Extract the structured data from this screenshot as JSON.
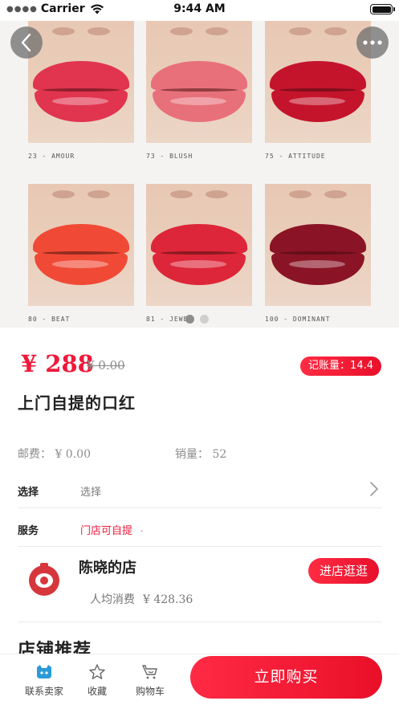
{
  "status_bar": {
    "carrier": "Carrier",
    "time": "9:44 AM"
  },
  "gallery": {
    "shades": [
      {
        "label": "23 - AMOUR",
        "color": "#e0344f"
      },
      {
        "label": "73 - BLUSH",
        "color": "#e8707a"
      },
      {
        "label": "75 - ATTITUDE",
        "color": "#c4142c"
      },
      {
        "label": "80 - BEAT",
        "color": "#f04a36"
      },
      {
        "label": "81 - JEWEL",
        "color": "#dd2639"
      },
      {
        "label": "100 - DOMINANT",
        "color": "#8a1425"
      }
    ],
    "page_count": 2,
    "active_page": 0
  },
  "product": {
    "price": "¥ 288",
    "original_price": "¥ 0.00",
    "badge": "记账量：14.4",
    "title": "上门自提的口红",
    "shipping_label": "邮费：",
    "shipping_value": "¥ 0.00",
    "sales_label": "销量：",
    "sales_value": "52"
  },
  "options": {
    "select_label": "选择",
    "select_value": "选择",
    "service_label": "服务",
    "service_value": "门店可自提",
    "service_dot": "·"
  },
  "store": {
    "name": "陈晓的店",
    "avg_label": "人均消费",
    "avg_value": "¥ 428.36",
    "visit_button": "进店逛逛"
  },
  "recommend": {
    "title": "店铺推荐"
  },
  "tabbar": {
    "contact": "联系卖家",
    "favorite": "收藏",
    "cart": "购物车",
    "buy": "立即购买"
  },
  "colors": {
    "accent": "#f0193a",
    "store_logo": "#d6373c"
  }
}
